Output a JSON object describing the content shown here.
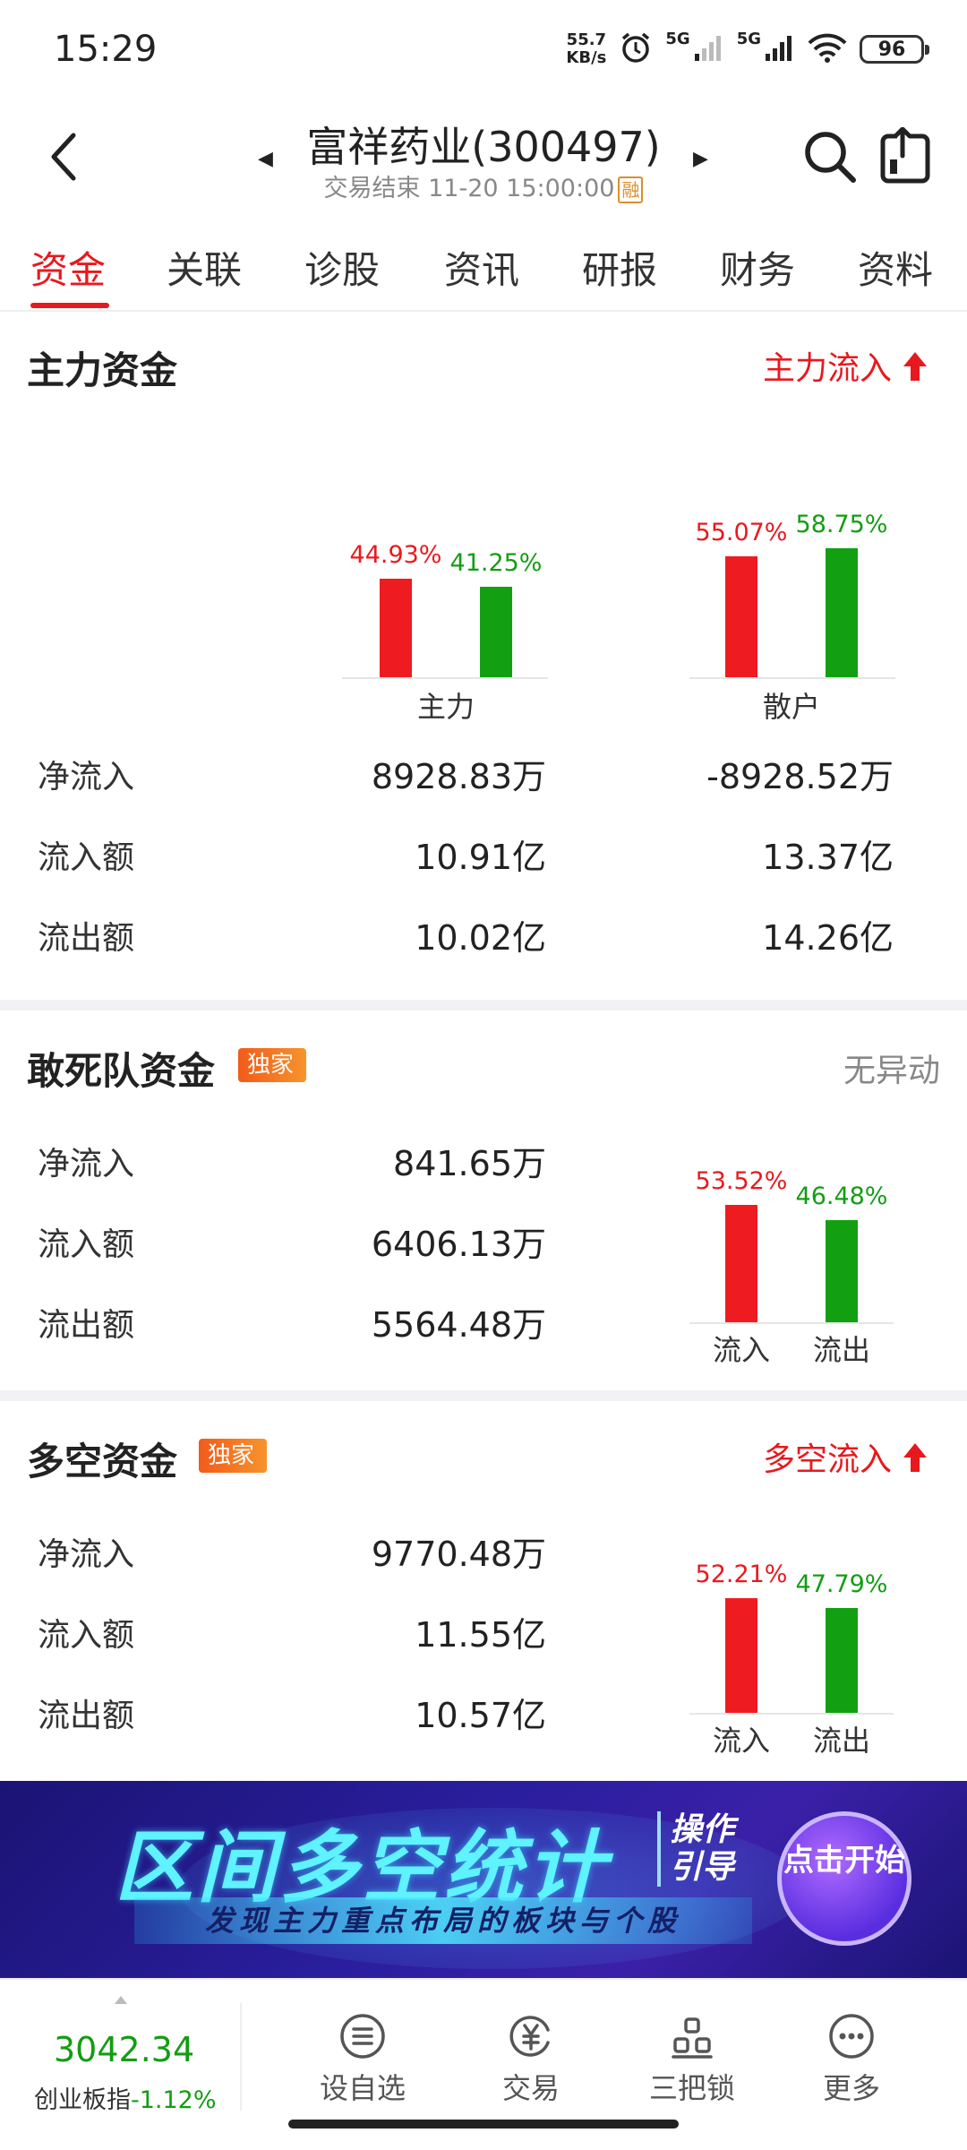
{
  "status_bar": {
    "time": "15:29",
    "net_speed_value": "55.7",
    "net_speed_unit": "KB/s",
    "sig1": "5G",
    "sig2": "5G",
    "battery": "96"
  },
  "header": {
    "title": "富祥药业(300497)",
    "subtitle": "交易结束 11-20 15:00:00",
    "margin_badge": "融"
  },
  "tabs": [
    "资金",
    "关联",
    "诊股",
    "资讯",
    "研报",
    "财务",
    "资料"
  ],
  "main_capital": {
    "title": "主力资金",
    "status": "主力流入",
    "groups": [
      {
        "label": "主力",
        "inflow_pct": "44.93%",
        "outflow_pct": "41.25%",
        "inflow_ratio": 0.4493,
        "outflow_ratio": 0.4125
      },
      {
        "label": "散户",
        "inflow_pct": "55.07%",
        "outflow_pct": "58.75%",
        "inflow_ratio": 0.5507,
        "outflow_ratio": 0.5875
      }
    ],
    "rows": [
      {
        "label": "净流入",
        "main": "8928.83万",
        "retail": "-8928.52万"
      },
      {
        "label": "流入额",
        "main": "10.91亿",
        "retail": "13.37亿"
      },
      {
        "label": "流出额",
        "main": "10.02亿",
        "retail": "14.26亿"
      }
    ]
  },
  "dare_capital": {
    "title": "敢死队资金",
    "badge": "独家",
    "status": "无异动",
    "rows": [
      {
        "label": "净流入",
        "value": "841.65万"
      },
      {
        "label": "流入额",
        "value": "6406.13万"
      },
      {
        "label": "流出额",
        "value": "5564.48万"
      }
    ],
    "chart": {
      "inflow_pct": "53.52%",
      "outflow_pct": "46.48%",
      "inflow_ratio": 0.5352,
      "outflow_ratio": 0.4648,
      "inflow_label": "流入",
      "outflow_label": "流出"
    }
  },
  "long_short": {
    "title": "多空资金",
    "badge": "独家",
    "status": "多空流入",
    "rows": [
      {
        "label": "净流入",
        "value": "9770.48万"
      },
      {
        "label": "流入额",
        "value": "11.55亿"
      },
      {
        "label": "流出额",
        "value": "10.57亿"
      }
    ],
    "chart": {
      "inflow_pct": "52.21%",
      "outflow_pct": "47.79%",
      "inflow_ratio": 0.5221,
      "outflow_ratio": 0.4779,
      "inflow_label": "流入",
      "outflow_label": "流出"
    }
  },
  "banner": {
    "title": "区间多空统计",
    "guide": "操作引导",
    "subtitle": "发现主力重点布局的板块与个股",
    "button": "点击开始"
  },
  "bottom_bar": {
    "index_value": "3042.34",
    "index_name": "创业板指",
    "index_change": "-1.12%",
    "nav": [
      "设自选",
      "交易",
      "三把锁",
      "更多"
    ]
  },
  "colors": {
    "up": "#e8191e",
    "down": "#139d13",
    "accent": "#e8191e"
  }
}
